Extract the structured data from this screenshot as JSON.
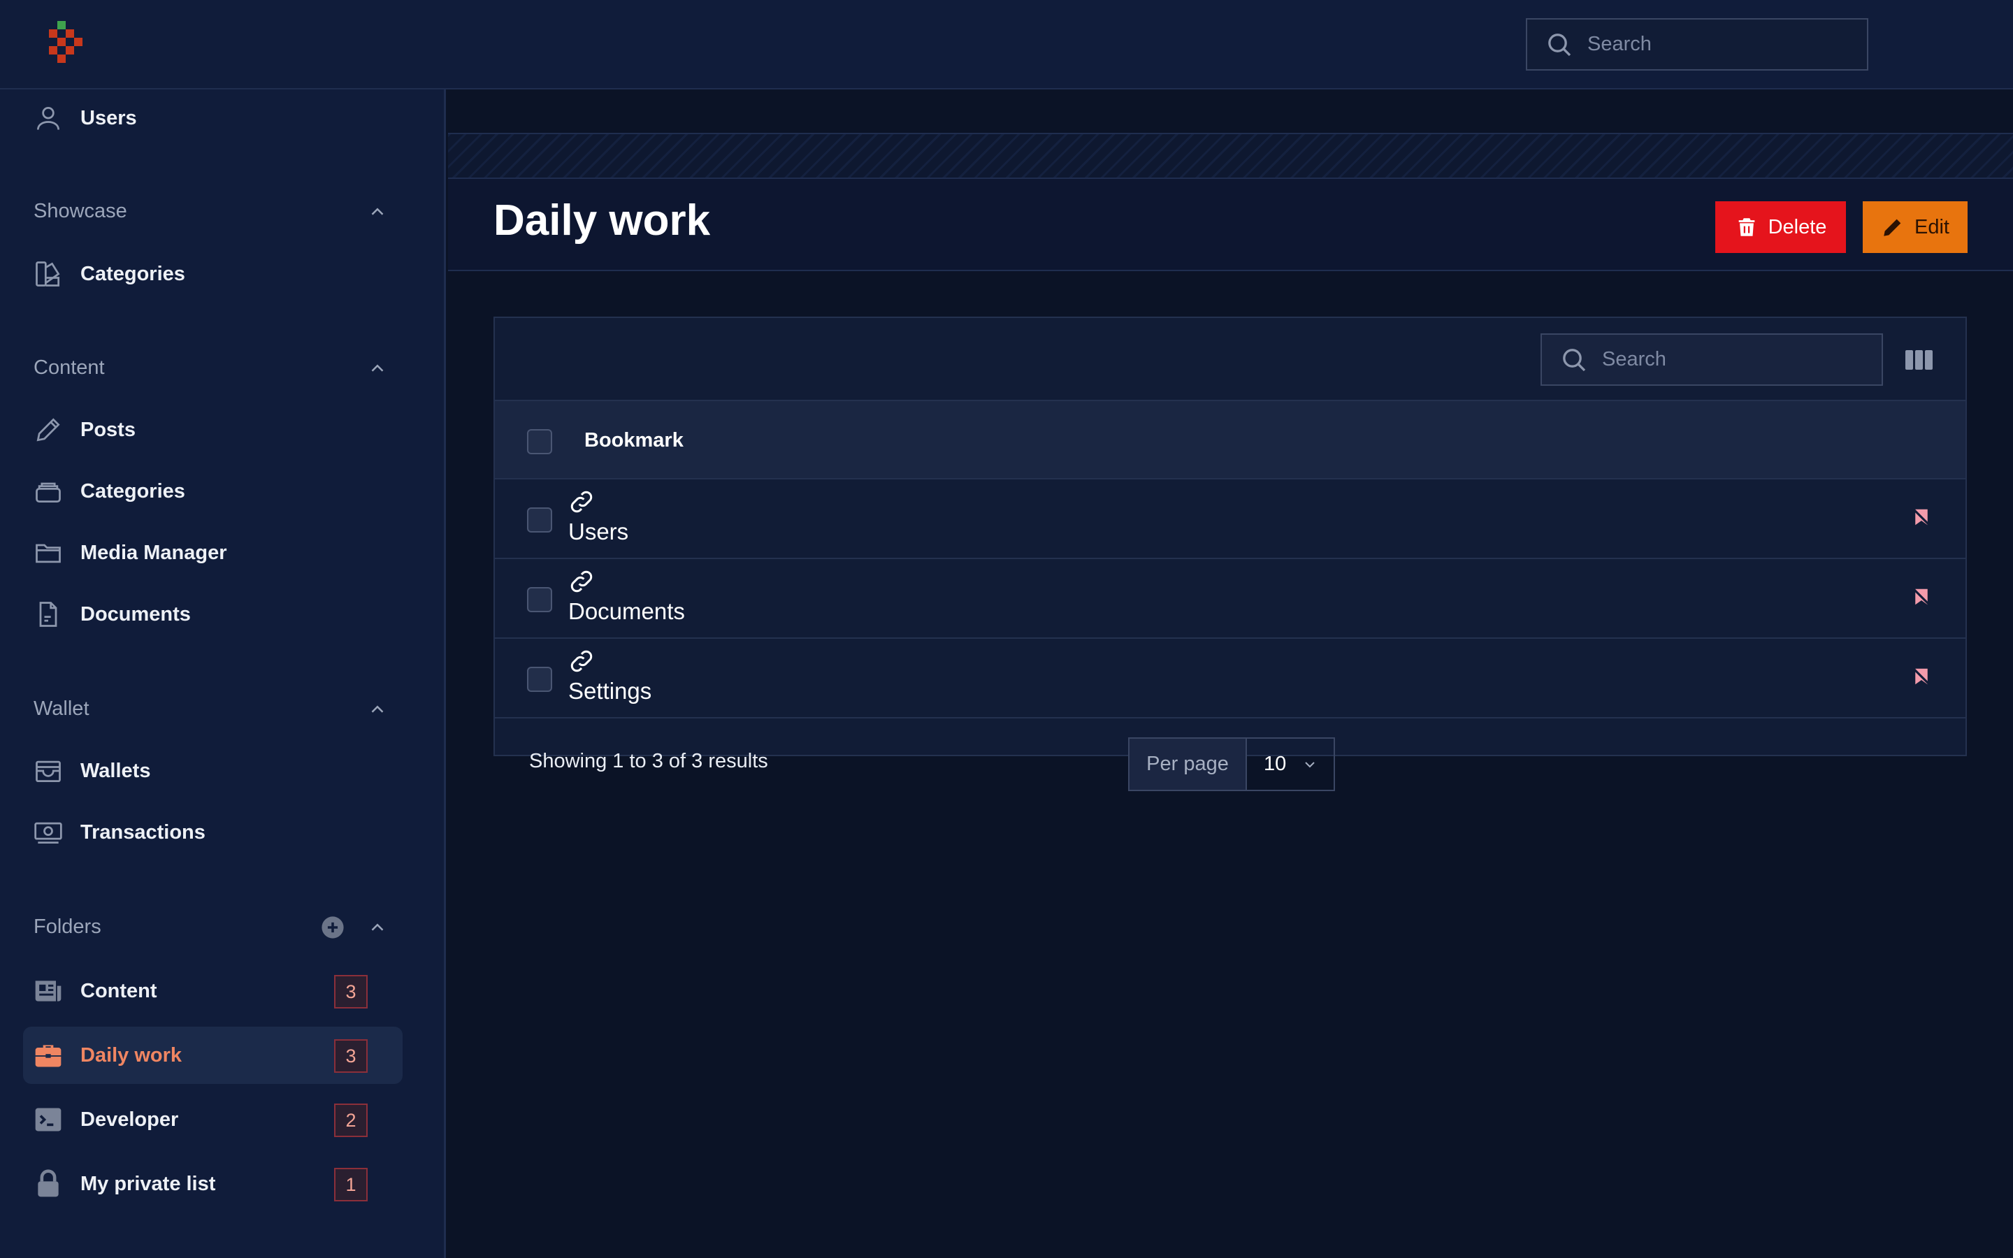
{
  "colors": {
    "background": "#0b1326",
    "sidebar": "#101c3a",
    "accent": "#f08662",
    "delete": "#e5141c",
    "edit": "#e8740e"
  },
  "topbar": {
    "search_placeholder": "Search",
    "logo_icon": "pixel-logo-icon"
  },
  "sidebar": {
    "top_items": [
      {
        "label": "Users",
        "icon": "user-icon"
      }
    ],
    "groups": {
      "showcase": {
        "title": "Showcase",
        "items": [
          {
            "label": "Categories",
            "icon": "swatch-icon"
          }
        ]
      },
      "content": {
        "title": "Content",
        "items": [
          {
            "label": "Posts",
            "icon": "pencil-icon"
          },
          {
            "label": "Categories",
            "icon": "stack-icon"
          },
          {
            "label": "Media Manager",
            "icon": "folder-icon"
          },
          {
            "label": "Documents",
            "icon": "document-icon"
          }
        ]
      },
      "wallet": {
        "title": "Wallet",
        "items": [
          {
            "label": "Wallets",
            "icon": "wallet-icon"
          },
          {
            "label": "Transactions",
            "icon": "banknote-icon"
          }
        ]
      },
      "folders": {
        "title": "Folders",
        "items": [
          {
            "label": "Content",
            "icon": "newspaper-icon",
            "count": "3"
          },
          {
            "label": "Daily work",
            "icon": "briefcase-icon",
            "count": "3",
            "active": true
          },
          {
            "label": "Developer",
            "icon": "terminal-icon",
            "count": "2"
          },
          {
            "label": "My private list",
            "icon": "lock-icon",
            "count": "1"
          }
        ]
      }
    }
  },
  "page": {
    "title": "Daily work",
    "delete_label": "Delete",
    "edit_label": "Edit"
  },
  "table": {
    "search_placeholder": "Search",
    "column_header": "Bookmark",
    "rows": [
      {
        "label": "Users"
      },
      {
        "label": "Documents"
      },
      {
        "label": "Settings"
      }
    ],
    "footer": {
      "summary": "Showing 1 to 3 of 3 results",
      "per_page_label": "Per page",
      "per_page_value": "10"
    }
  }
}
